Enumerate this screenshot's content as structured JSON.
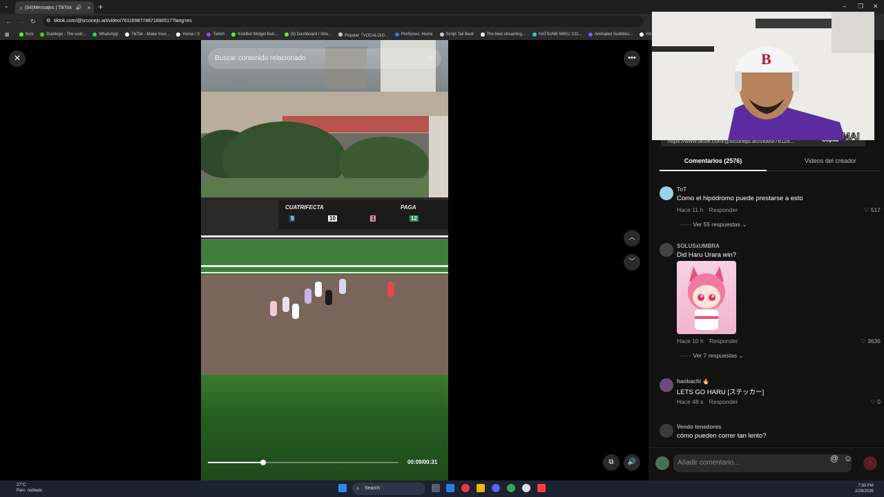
{
  "browser": {
    "tab_title": "(64)Mensajes | TikTok",
    "url": "tiktok.com/@srconejo.art/video/7611698774871690517?lang=es",
    "bookmarks": [
      {
        "label": "Kick",
        "color": "#53fc18"
      },
      {
        "label": "Duolingo - The worl...",
        "color": "#58cc02"
      },
      {
        "label": "WhatsApp",
        "color": "#25d366"
      },
      {
        "label": "TikTok - Make Your...",
        "color": "#ffffff"
      },
      {
        "label": "Home / X",
        "color": "#ffffff"
      },
      {
        "label": "Twitch",
        "color": "#9146ff"
      },
      {
        "label": "KickBot Widget Buil...",
        "color": "#53fc18"
      },
      {
        "label": "(5) Dashboard / Stre...",
        "color": "#53fc18"
      },
      {
        "label": "Popular「VOCALOID...",
        "color": "#cccccc"
      },
      {
        "label": "PreSonus: Home",
        "color": "#2b7de9"
      },
      {
        "label": "Script Tail Beat",
        "color": "#cccccc"
      },
      {
        "label": "The best streaming...",
        "color": "#ffffff"
      },
      {
        "label": "HATSUNE MIKU: CO...",
        "color": "#39c5bb"
      },
      {
        "label": "Animated Subtitles...",
        "color": "#7a5af8"
      },
      {
        "label": "HA",
        "color": "#ffffff"
      }
    ]
  },
  "video": {
    "search_placeholder": "Buscar contenido relacionado",
    "board_left": "CUATRIFECTA",
    "board_right": "PAGA",
    "board_numbers": [
      "9",
      "10",
      "1",
      "12"
    ],
    "time": "00:09/00:31",
    "progress_fraction": 0.29
  },
  "panel": {
    "share_link": "https://www.tiktok.com/@srconejo.art/video/76116...",
    "copy_label": "Copiar",
    "tabs": {
      "comments": "Comentarios (2576)",
      "creator_videos": "Videos del creador"
    },
    "comments": [
      {
        "user": "ToT",
        "text": "Como el hipódromo puede prestarse a esto",
        "time": "Hace 11 h",
        "reply": "Responder",
        "likes": "517",
        "replies": "Ver 55 respuestas",
        "avatar_color": "#9ad1e6"
      },
      {
        "user": "SOLUSxUMBRA",
        "text": "Did Haru Urara win?",
        "time": "Hace 10 h",
        "reply": "Responder",
        "likes": "3636",
        "replies": "Ver 7 respuestas",
        "avatar_color": "#444444"
      },
      {
        "user": "haobachi 🔥",
        "text": "LETS GO HARU [ステッカー]",
        "time": "Hace 48 s",
        "reply": "Responder",
        "likes": "0",
        "avatar_color": "#6a4a7a"
      },
      {
        "user": "Vendo tenedores",
        "text": "cómo pueden correr tan lento?",
        "avatar_color": "#3a3a3a"
      }
    ],
    "compose_placeholder": "Añadir comentario...",
    "webcam_tag": "MAI"
  },
  "taskbar": {
    "temp": "27°C",
    "weather": "Parc. nublado",
    "search": "Search",
    "time": "7:30 PM",
    "date": "2/28/2026"
  },
  "icons": [
    "close-icon",
    "more-icon",
    "chevron-up-icon",
    "chevron-down-icon",
    "search-icon",
    "volume-icon",
    "floating-player-icon",
    "heart-icon",
    "mention-icon",
    "emoji-icon",
    "send-icon"
  ]
}
